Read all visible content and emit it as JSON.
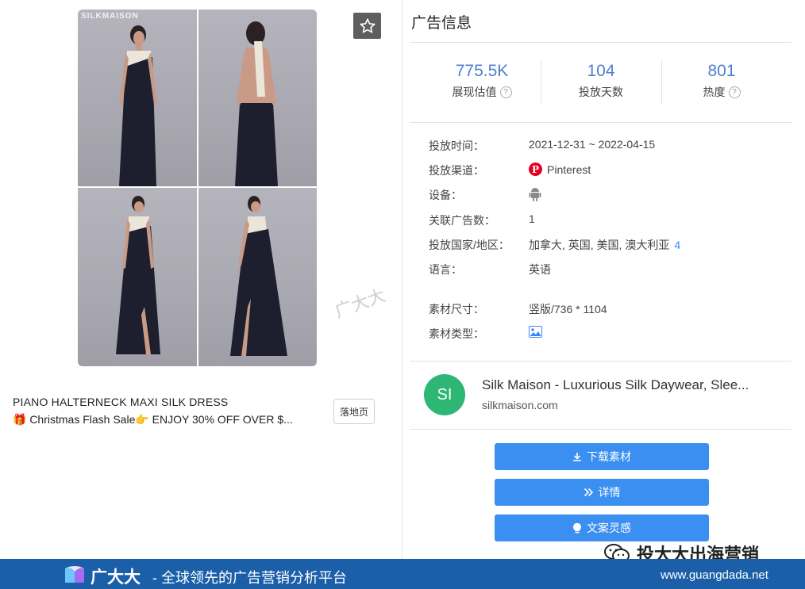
{
  "creative": {
    "brand_mark": "SILKMAISON",
    "title": "PIANO HALTERNECK MAXI SILK DRESS",
    "text": "🎁 Christmas Flash Sale👉 ENJOY 30% OFF OVER $...",
    "landing_label": "落地页",
    "favorite_icon": "star-outline-icon",
    "watermark": "广大大"
  },
  "panel": {
    "title": "广告信息",
    "stats": [
      {
        "value": "775.5K",
        "label": "展现估值"
      },
      {
        "value": "104",
        "label": "投放天数"
      },
      {
        "value": "801",
        "label": "热度"
      }
    ],
    "details": {
      "time_key": "投放时间：",
      "time_val": "2021-12-31 ~ 2022-04-15",
      "channel_key": "投放渠道：",
      "channel_val": "Pinterest",
      "device_key": "设备：",
      "device_icon": "android-icon",
      "related_key": "关联广告数：",
      "related_val": "1",
      "region_key": "投放国家/地区：",
      "region_val": "加拿大, 英国, 美国, 澳大利亚",
      "region_more": "4",
      "lang_key": "语言：",
      "lang_val": "英语",
      "size_key": "素材尺寸：",
      "size_val": "竖版/736 * 1104",
      "type_key": "素材类型：",
      "type_icon": "image-icon"
    },
    "advertiser": {
      "avatar": "SI",
      "name": "Silk Maison - Luxurious Silk Daywear, Slee...",
      "domain": "silkmaison.com"
    },
    "actions": {
      "download": "下载素材",
      "detail": "详情",
      "inspiration": "文案灵感"
    }
  },
  "banner": {
    "brand": "广大大",
    "slogan": "- 全球领先的广告营销分析平台",
    "url": "www.guangdada.net",
    "wechat": "投大大出海营销"
  },
  "colors": {
    "accent": "#3a8ff0",
    "stat_value": "#4e7fcf",
    "banner": "#1b5fa8",
    "avatar": "#2db674",
    "pinterest": "#e60023"
  }
}
